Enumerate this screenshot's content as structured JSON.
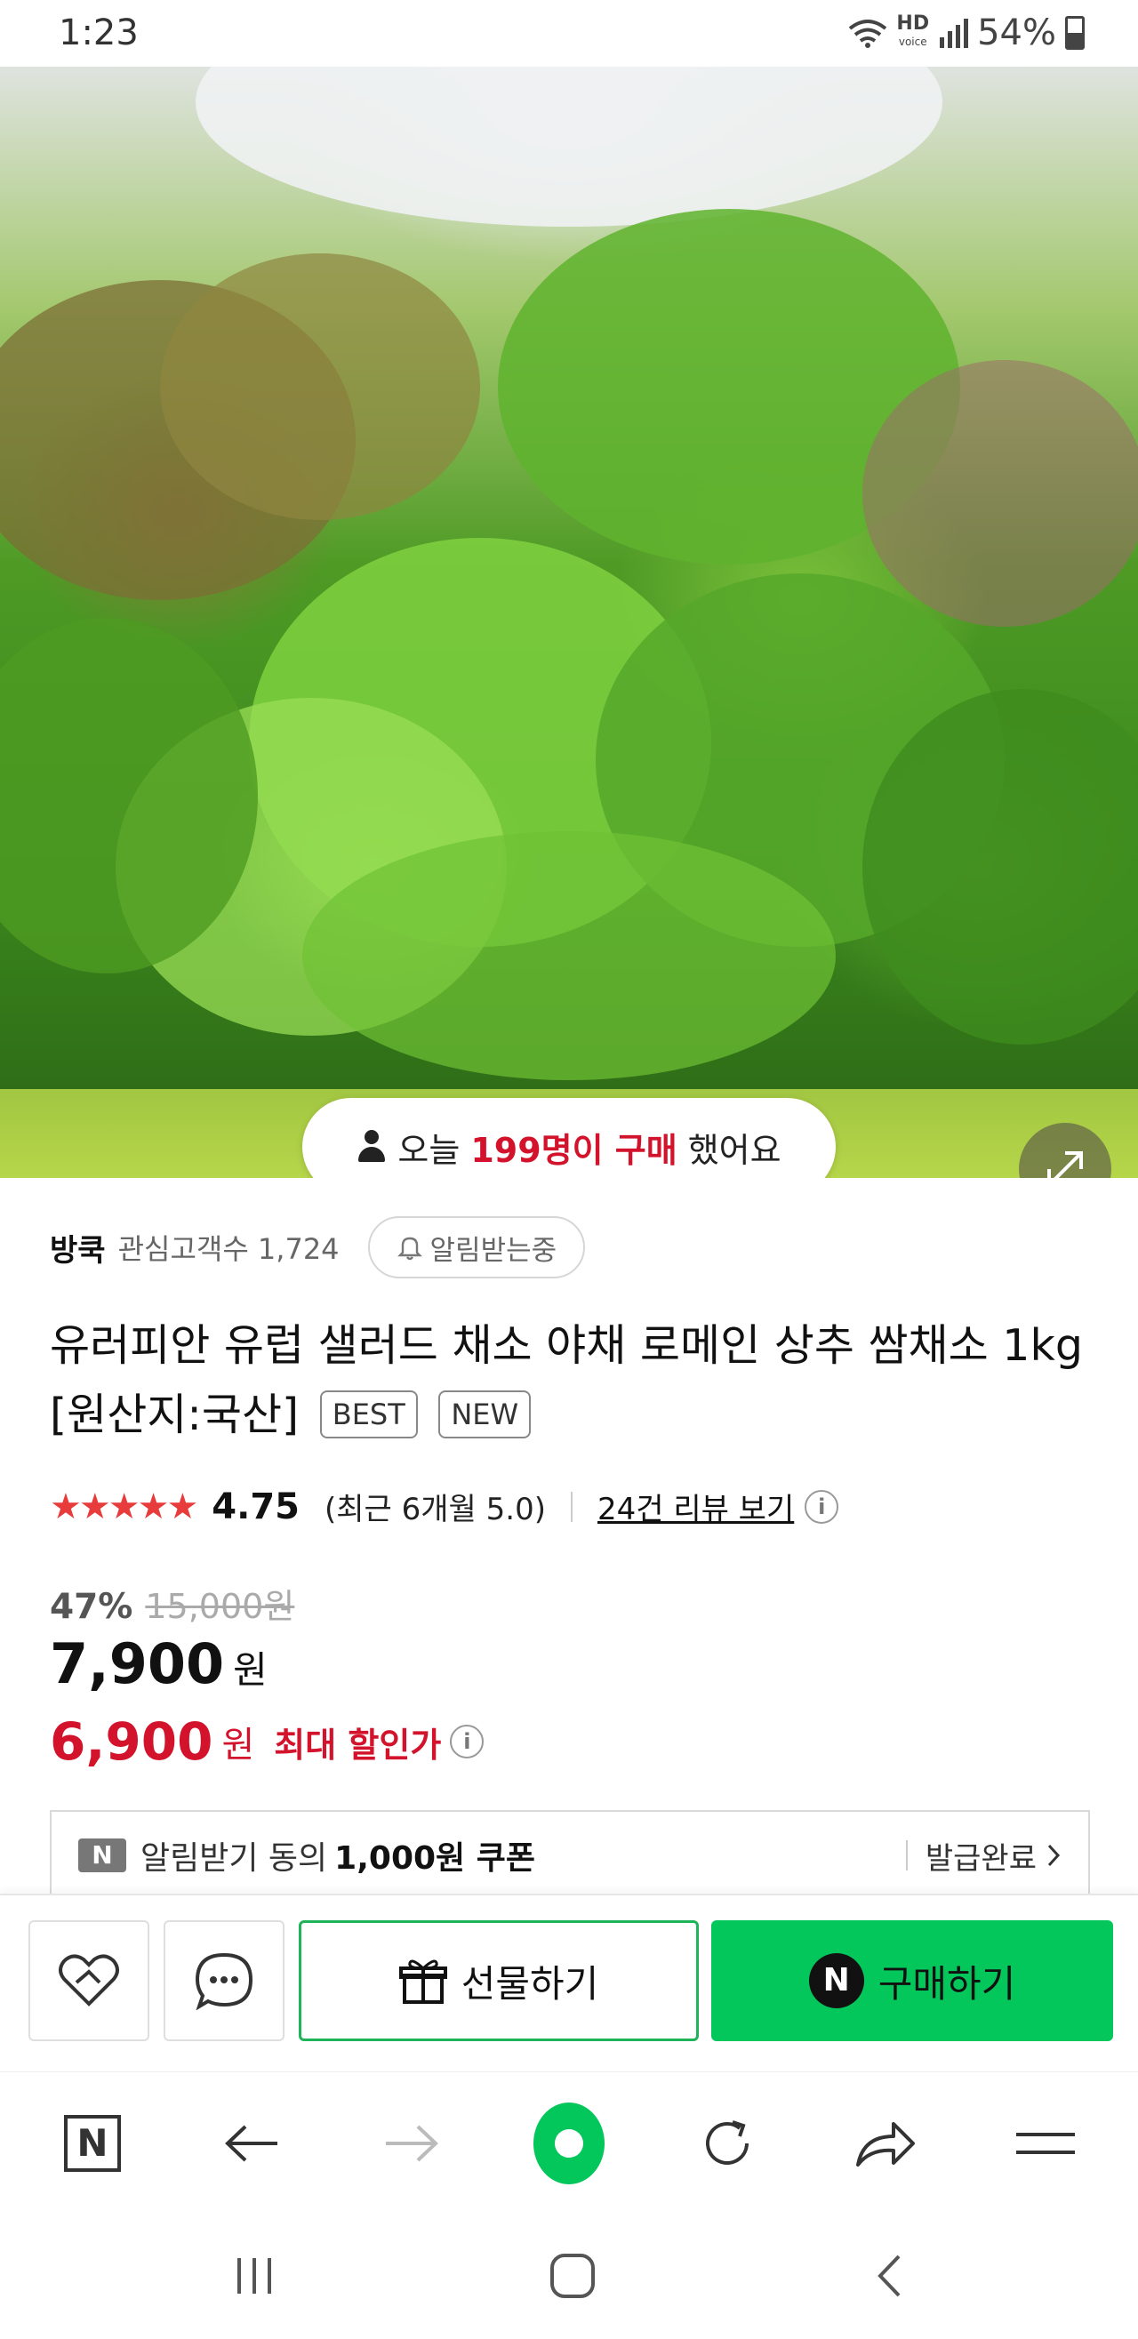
{
  "status": {
    "time": "1:23",
    "hd_label": "HD",
    "voice_label": "voice",
    "battery": "54%"
  },
  "hero": {
    "buyers_prefix": "오늘",
    "buyers_highlight": "199명이 구매",
    "buyers_suffix": "했어요"
  },
  "seller": {
    "name": "방쿡",
    "fans": "관심고객수 1,724",
    "notify_label": "알림받는중"
  },
  "product": {
    "title": "유러피안 유럽 샐러드 채소 야채 로메인 상추 쌈채소 1kg [원산지:국산]",
    "badges": [
      "BEST",
      "NEW"
    ]
  },
  "rating": {
    "stars": "★★★★★",
    "score": "4.75",
    "recent": "(최근 6개월 5.0)",
    "review_link": "24건 리뷰 보기",
    "info": "i"
  },
  "price": {
    "discount_rate": "47%",
    "original": "15,000원",
    "price": "7,900",
    "unit": "원",
    "max_discount_price": "6,900",
    "max_discount_unit": "원",
    "max_discount_label": "최대 할인가",
    "info": "i"
  },
  "coupon": {
    "badge": "N",
    "text": "알림받기 동의",
    "amount": "1,000원 쿠폰",
    "status": "발급완료"
  },
  "actions": {
    "gift_label": "선물하기",
    "buy_badge": "N",
    "buy_label": "구매하기"
  },
  "browser": {
    "home_label": "N"
  },
  "colors": {
    "accent_green": "#03c75a",
    "price_red": "#d3132b",
    "star_red": "#e83b3b"
  },
  "icons": [
    "wifi-icon",
    "signal-icon",
    "battery-icon",
    "person-icon",
    "expand-icon",
    "bell-icon",
    "wishlist-icon",
    "chat-icon",
    "gift-icon",
    "back-arrow-icon",
    "forward-arrow-icon",
    "refresh-icon",
    "share-icon",
    "menu-icon",
    "recent-apps-icon",
    "home-icon",
    "back-icon"
  ]
}
